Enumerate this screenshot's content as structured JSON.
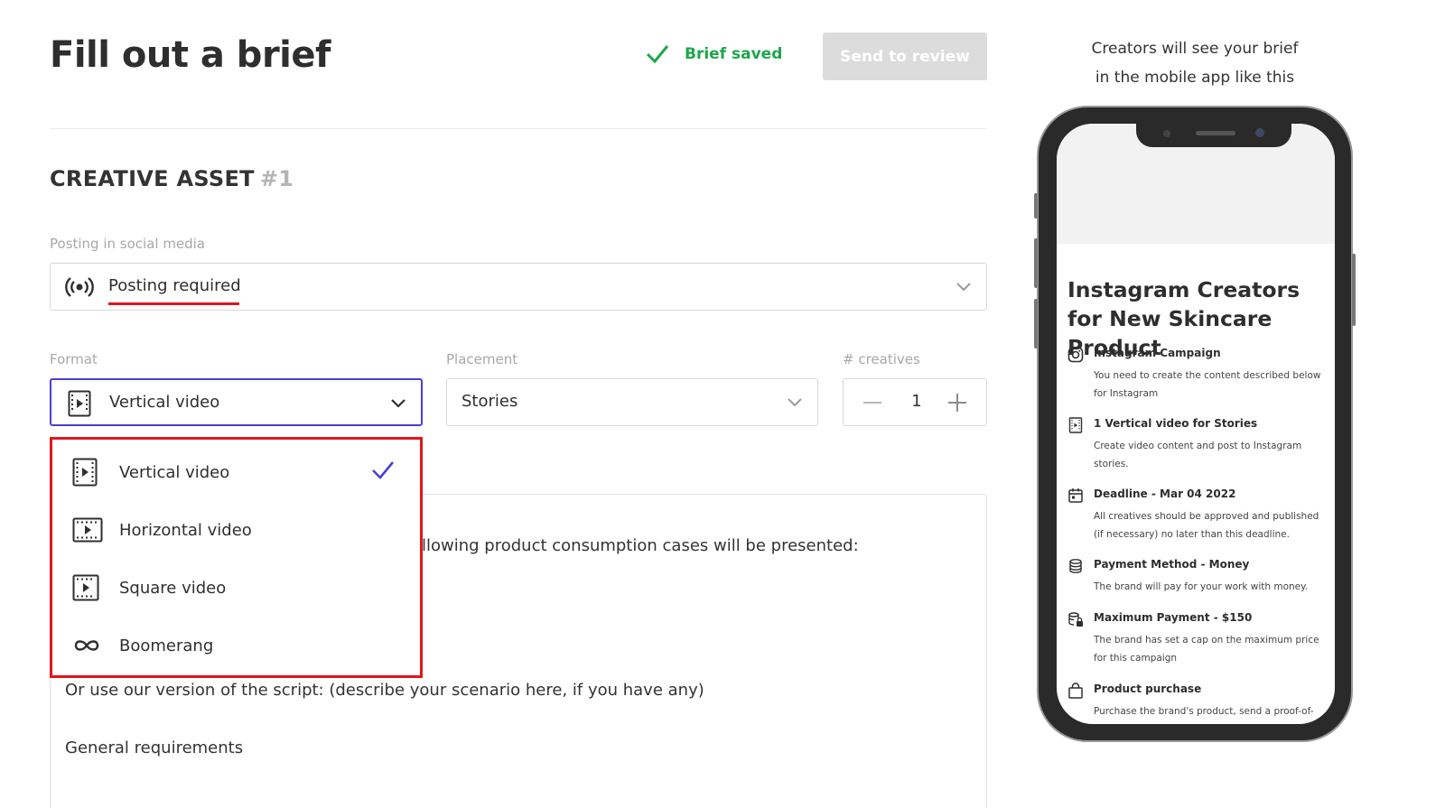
{
  "header": {
    "title": "Fill out a brief",
    "saved_text": "Brief saved",
    "send_button": "Send to review"
  },
  "asset": {
    "title": "CREATIVE ASSET",
    "number": "#1"
  },
  "posting": {
    "label": "Posting in social media",
    "value": "Posting required"
  },
  "format": {
    "label": "Format",
    "value": "Vertical video",
    "options": [
      {
        "label": "Vertical video",
        "icon": "vertical-video-icon",
        "selected": true
      },
      {
        "label": "Horizontal video",
        "icon": "horizontal-video-icon",
        "selected": false
      },
      {
        "label": "Square video",
        "icon": "square-video-icon",
        "selected": false
      },
      {
        "label": "Boomerang",
        "icon": "infinity-icon",
        "selected": false
      }
    ]
  },
  "placement": {
    "label": "Placement",
    "value": "Stories"
  },
  "creatives": {
    "label": "# creatives",
    "count": "1"
  },
  "description": {
    "line1": "llowing product consumption cases will be presented:",
    "line2": "Or use our version of the script: (describe your scenario here, if you have any)",
    "line3": "General requirements"
  },
  "preview": {
    "caption_line1": "Creators will see your brief",
    "caption_line2": "in the mobile app like this",
    "app_title": "Instagram Creators for New Skincare Product",
    "items": [
      {
        "icon": "instagram-icon",
        "title": "Instagram Campaign",
        "desc": "You need to create the content described below for Instagram"
      },
      {
        "icon": "vertical-video-icon",
        "title": "1 Vertical video for Stories",
        "desc": "Create video content and post to Instagram stories."
      },
      {
        "icon": "calendar-icon",
        "title": "Deadline - Mar 04 2022",
        "desc": "All creatives should be approved and published (if necessary) no later than this deadline."
      },
      {
        "icon": "coins-icon",
        "title": "Payment Method - Money",
        "desc": "The brand will pay for your work with money."
      },
      {
        "icon": "locked-coins-icon",
        "title": "Maximum Payment - $150",
        "desc": "The brand has set a cap on the maximum price for this campaign"
      },
      {
        "icon": "shopping-bag-icon",
        "title": "Product purchase",
        "desc": "Purchase the brand's product, send a proof-of-purchase, and the brand will reimburse you"
      }
    ]
  },
  "colors": {
    "accent": "#4a3fd6",
    "success": "#1fa64a",
    "highlight": "#e0161b"
  }
}
